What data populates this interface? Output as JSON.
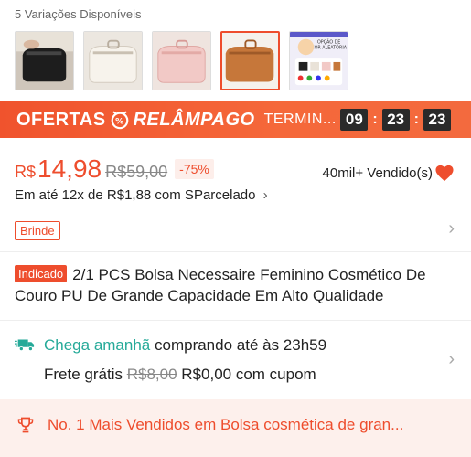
{
  "variations": {
    "label": "5 Variações Disponíveis",
    "thumbnails": [
      {
        "name": "black-bag"
      },
      {
        "name": "cream-bag"
      },
      {
        "name": "pink-bag"
      },
      {
        "name": "brown-bag",
        "selected": true
      },
      {
        "name": "promo-card",
        "caption_line1": "OPÇÃO DE",
        "caption_line2": "COR ALEATÓRIA"
      }
    ]
  },
  "flash_sale": {
    "title_part1": "OFERTAS",
    "title_part2": "RELÂMPAGO",
    "ending_label": "TERMIN...",
    "countdown": {
      "hours": "09",
      "minutes": "23",
      "seconds": "23"
    },
    "icon": "clock-percent-icon"
  },
  "price": {
    "currency": "R$",
    "current": "14,98",
    "original": "R$59,00",
    "discount": "-75%",
    "sold": "40mil+ Vendido(s)",
    "installments": "Em até 12x de R$1,88 com SParcelado",
    "installments_chevron": "›",
    "gift_tag": "Brinde"
  },
  "product": {
    "tag": "Indicado",
    "title": "2/1 PCS Bolsa Necessaire Feminino Cosmético De Couro PU De Grande Capacidade Em Alto Qualidade"
  },
  "delivery": {
    "arrival_highlight": "Chega amanhã",
    "arrival_rest": "comprando até às 23h59",
    "shipping_label": "Frete grátis",
    "shipping_old": "R$8,00",
    "shipping_new": "R$0,00 com cupom"
  },
  "bestseller": {
    "text": "No. 1 Mais Vendidos em Bolsa cosmética de gran..."
  },
  "colors": {
    "accent": "#ee4d2d",
    "green": "#26aa99",
    "heart": "#ee4d2d"
  }
}
